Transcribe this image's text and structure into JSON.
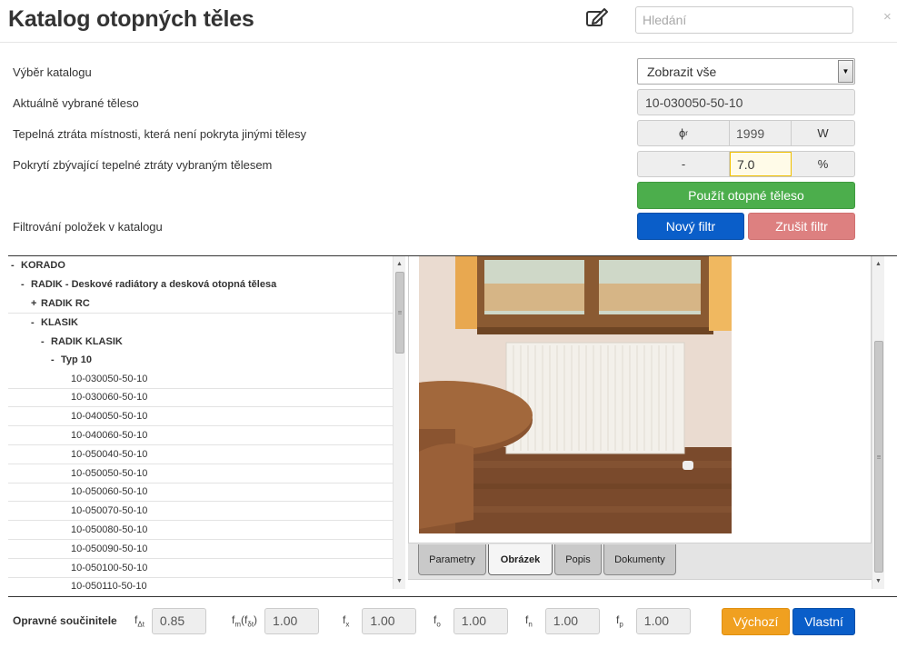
{
  "header": {
    "title": "Katalog otopných těles",
    "search_placeholder": "Hledání",
    "close_glyph": "×"
  },
  "form": {
    "catalog_label": "Výběr katalogu",
    "catalog_value": "Zobrazit vše",
    "selected_label": "Aktuálně vybrané těleso",
    "selected_value": "10-030050-50-10",
    "heat_loss_label": "Tepelná ztráta místnosti, která není pokryta jinými tělesy",
    "heat_loss_symbol": "ϕ",
    "heat_loss_symbol_sub": "r",
    "heat_loss_value": "1999",
    "heat_loss_unit": "W",
    "coverage_label": "Pokrytí zbývající tepelné ztráty vybraným tělesem",
    "coverage_symbol": "-",
    "coverage_value": "7.0",
    "coverage_unit": "%",
    "filter_label": "Filtrování položek v katalogu",
    "use_button": "Použít otopné těleso",
    "new_filter_button": "Nový filtr",
    "cancel_filter_button": "Zrušit filtr"
  },
  "tree": {
    "nodes": [
      {
        "toggle": "-",
        "label": "KORADO",
        "bold": true,
        "level": 0
      },
      {
        "toggle": "-",
        "label": "RADIK - Deskové radiátory a desková otopná tělesa",
        "bold": true,
        "level": 1
      },
      {
        "toggle": "+",
        "label": "RADIK RC",
        "bold": true,
        "level": 2
      },
      {
        "toggle": "-",
        "label": "KLASIK",
        "bold": true,
        "level": 2
      },
      {
        "toggle": "-",
        "label": "RADIK KLASIK",
        "bold": true,
        "level": 3
      },
      {
        "toggle": "-",
        "label": "Typ 10",
        "bold": true,
        "level": 4
      },
      {
        "toggle": "",
        "label": "10-030050-50-10",
        "bold": false,
        "level": 5
      },
      {
        "toggle": "",
        "label": "10-030060-50-10",
        "bold": false,
        "level": 5
      },
      {
        "toggle": "",
        "label": "10-040050-50-10",
        "bold": false,
        "level": 5
      },
      {
        "toggle": "",
        "label": "10-040060-50-10",
        "bold": false,
        "level": 5
      },
      {
        "toggle": "",
        "label": "10-050040-50-10",
        "bold": false,
        "level": 5
      },
      {
        "toggle": "",
        "label": "10-050050-50-10",
        "bold": false,
        "level": 5
      },
      {
        "toggle": "",
        "label": "10-050060-50-10",
        "bold": false,
        "level": 5
      },
      {
        "toggle": "",
        "label": "10-050070-50-10",
        "bold": false,
        "level": 5
      },
      {
        "toggle": "",
        "label": "10-050080-50-10",
        "bold": false,
        "level": 5
      },
      {
        "toggle": "",
        "label": "10-050090-50-10",
        "bold": false,
        "level": 5
      },
      {
        "toggle": "",
        "label": "10-050100-50-10",
        "bold": false,
        "level": 5
      },
      {
        "toggle": "",
        "label": "10-050110-50-10",
        "bold": false,
        "level": 5
      }
    ]
  },
  "tabs": [
    {
      "label": "Parametry",
      "active": false
    },
    {
      "label": "Obrázek",
      "active": true
    },
    {
      "label": "Popis",
      "active": false
    },
    {
      "label": "Dokumenty",
      "active": false
    }
  ],
  "coefficients": {
    "label": "Opravné součinitele",
    "items": [
      {
        "symbol": "f",
        "sub": "Δt",
        "suffix": "",
        "value": "0.85"
      },
      {
        "symbol": "f",
        "sub": "m",
        "suffix": "(f",
        "suffix_sub": "δt",
        "suffix_end": ")",
        "value": "1.00"
      },
      {
        "symbol": "f",
        "sub": "x",
        "suffix": "",
        "value": "1.00"
      },
      {
        "symbol": "f",
        "sub": "o",
        "suffix": "",
        "value": "1.00"
      },
      {
        "symbol": "f",
        "sub": "n",
        "suffix": "",
        "value": "1.00"
      },
      {
        "symbol": "f",
        "sub": "p",
        "suffix": "",
        "value": "1.00"
      }
    ],
    "default_button": "Výchozí",
    "custom_button": "Vlastní"
  },
  "colors": {
    "green": "#4cae4c",
    "blue": "#0a5ec9",
    "red": "#dd8080",
    "orange": "#f0a020",
    "highlight_border": "#f0c000"
  },
  "icons": [
    "edit-icon",
    "close-icon",
    "dropdown-arrow-icon",
    "scroll-up-icon",
    "scroll-down-icon"
  ]
}
